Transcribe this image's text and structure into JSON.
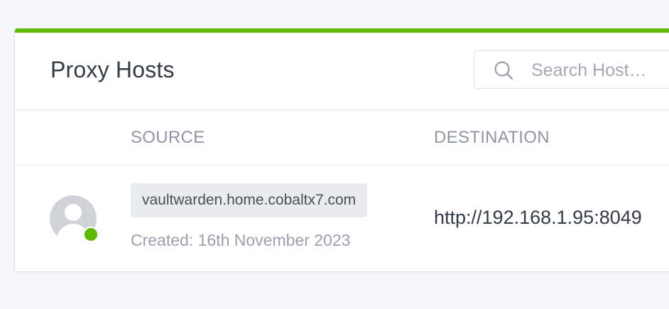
{
  "colors": {
    "accent": "#5eba00",
    "status_online": "#5eba00"
  },
  "card": {
    "title": "Proxy Hosts",
    "search": {
      "placeholder": "Search Host…",
      "value": "",
      "icon": "search-icon"
    }
  },
  "table": {
    "columns": [
      "SOURCE",
      "DESTINATION"
    ],
    "rows": [
      {
        "avatar_icon": "user-avatar-icon",
        "status": "online",
        "source": "vaultwarden.home.cobaltx7.com",
        "created": "Created: 16th November 2023",
        "destination": "http://192.168.1.95:8049"
      }
    ]
  }
}
